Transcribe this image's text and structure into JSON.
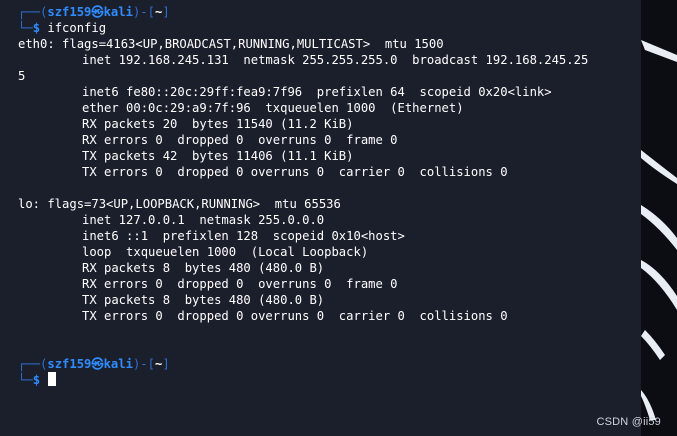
{
  "theme": {
    "terminal_bg": "#1b1f2c",
    "prompt_blue": "#2f8cff",
    "frame_blue": "#2f6fcf",
    "text": "#ffffff"
  },
  "prompt": {
    "frame_top": "┌──(",
    "user": "szf159",
    "at_symbol": "㉿",
    "host": "kali",
    "close_paren": ")",
    "dash": "-",
    "dir_open": "[",
    "dir": "~",
    "dir_close": "]",
    "frame_bottom": "└─",
    "dollar": "$"
  },
  "command": "ifconfig",
  "output": {
    "eth0": {
      "header": "eth0: flags=4163<UP,BROADCAST,RUNNING,MULTICAST>  mtu 1500",
      "lines": [
        "inet 192.168.245.131  netmask 255.255.255.0  broadcast 192.168.245.25",
        "inet6 fe80::20c:29ff:fea9:7f96  prefixlen 64  scopeid 0x20<link>",
        "ether 00:0c:29:a9:7f:96  txqueuelen 1000  (Ethernet)",
        "RX packets 20  bytes 11540 (11.2 KiB)",
        "RX errors 0  dropped 0  overruns 0  frame 0",
        "TX packets 42  bytes 11406 (11.1 KiB)",
        "TX errors 0  dropped 0 overruns 0  carrier 0  collisions 0"
      ],
      "wrap": "5"
    },
    "lo": {
      "header": "lo: flags=73<UP,LOOPBACK,RUNNING>  mtu 65536",
      "lines": [
        "inet 127.0.0.1  netmask 255.0.0.0",
        "inet6 ::1  prefixlen 128  scopeid 0x10<host>",
        "loop  txqueuelen 1000  (Local Loopback)",
        "RX packets 8  bytes 480 (480.0 B)",
        "RX errors 0  dropped 0  overruns 0  frame 0",
        "TX packets 8  bytes 480 (480.0 B)",
        "TX errors 0  dropped 0 overruns 0  carrier 0  collisions 0"
      ]
    }
  },
  "watermark": "CSDN @ii59",
  "icons": {
    "cursor": "block-cursor-icon"
  }
}
